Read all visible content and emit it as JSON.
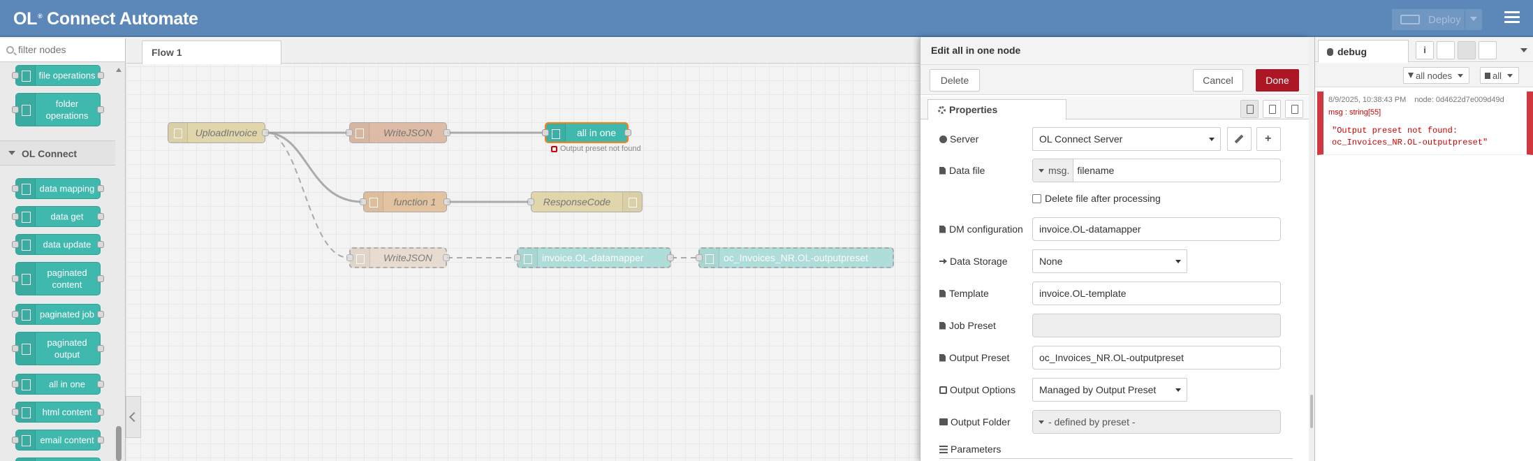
{
  "header": {
    "brand": "OL",
    "brand_mark": "®",
    "brand_rest": "Connect Automate",
    "deploy_label": "Deploy"
  },
  "palette": {
    "filter_placeholder": "filter nodes",
    "nodes_top": [
      {
        "label": "file operations"
      },
      {
        "label": "folder operations"
      }
    ],
    "category": "OL Connect",
    "nodes": [
      {
        "label": "data mapping"
      },
      {
        "label": "data get"
      },
      {
        "label": "data update"
      },
      {
        "label": "paginated content"
      },
      {
        "label": "paginated job"
      },
      {
        "label": "paginated output"
      },
      {
        "label": "all in one"
      },
      {
        "label": "html content"
      },
      {
        "label": "email content"
      }
    ]
  },
  "workspace": {
    "tab": "Flow 1",
    "nodes": {
      "upload": "UploadInvoice",
      "writejson1": "WriteJSON",
      "allinone": "all in one",
      "function1": "function 1",
      "response": "ResponseCode",
      "writejson2": "WriteJSON",
      "datamapper": "invoice.OL-datamapper",
      "outputpreset": "oc_Invoices_NR.OL-outputpreset"
    },
    "status_text": "Output preset not found"
  },
  "tray": {
    "title": "Edit all in one node",
    "delete_label": "Delete",
    "cancel_label": "Cancel",
    "done_label": "Done",
    "properties_tab": "Properties",
    "fields": {
      "server_label": "Server",
      "server_value": "OL Connect Server",
      "datafile_label": "Data file",
      "datafile_type": "msg.",
      "datafile_value": "filename",
      "delete_checkbox_label": "Delete file after processing",
      "dm_label": "DM configuration",
      "dm_value": "invoice.OL-datamapper",
      "storage_label": "Data Storage",
      "storage_value": "None",
      "template_label": "Template",
      "template_value": "invoice.OL-template",
      "jobpreset_label": "Job Preset",
      "jobpreset_value": "",
      "outputpreset_label": "Output Preset",
      "outputpreset_value": "oc_Invoices_NR.OL-outputpreset",
      "outputoptions_label": "Output Options",
      "outputoptions_value": "Managed by Output Preset",
      "outputfolder_label": "Output Folder",
      "outputfolder_value": "- defined by preset -",
      "parameters_label": "Parameters"
    }
  },
  "sidebar": {
    "tab_label": "debug",
    "info_icon": "i",
    "filter_label": "all nodes",
    "clear_label": "all",
    "message": {
      "timestamp": "8/9/2025, 10:38:43 PM",
      "node": "node: 0d4622d7e009d49d",
      "topic": "msg : string[55]",
      "value": "\"Output preset not found:\noc_Invoices_NR.OL-outputpreset\""
    }
  },
  "colors": {
    "header": "#5b87b9",
    "node_teal": "#3fb8ae",
    "done_button": "#ad1625",
    "error": "#d0373f"
  }
}
